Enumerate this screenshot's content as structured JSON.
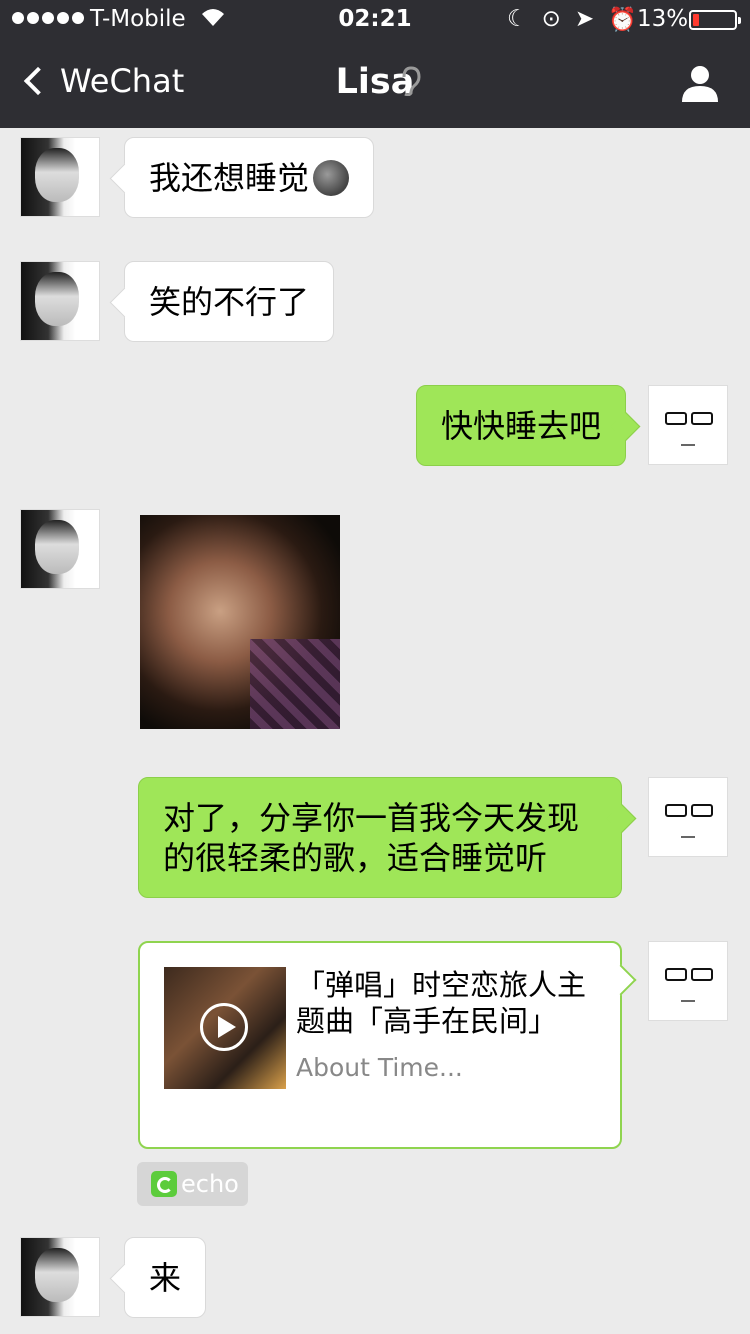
{
  "status": {
    "carrier": "T-Mobile",
    "time": "02:21",
    "battery_pct": "13%"
  },
  "nav": {
    "back_label": "WeChat",
    "title": "Lisa"
  },
  "messages": [
    {
      "from": "Lisa",
      "text": "我还想睡觉",
      "emoji": "moon-face"
    },
    {
      "from": "Lisa",
      "text": "笑的不行了"
    },
    {
      "from": "me",
      "text": "快快睡去吧"
    },
    {
      "from": "Lisa",
      "type": "image"
    },
    {
      "from": "me",
      "text_line1": "对了，分享你一首我今天发现",
      "text_line2": "的很轻柔的歌，适合睡觉听"
    },
    {
      "from": "me",
      "type": "music-card",
      "title_line1": "「弹唱」时空恋旅人主",
      "title_line2": "题曲「高手在民间」",
      "subtitle": "About Time..."
    },
    {
      "from": "Lisa",
      "text": "来"
    }
  ],
  "share_source": {
    "label": "echo",
    "color": "#5ccc3c"
  },
  "colors": {
    "nav_bg": "#2e2e33",
    "bubble_out": "#9fe658",
    "chat_bg": "#ebebeb"
  }
}
